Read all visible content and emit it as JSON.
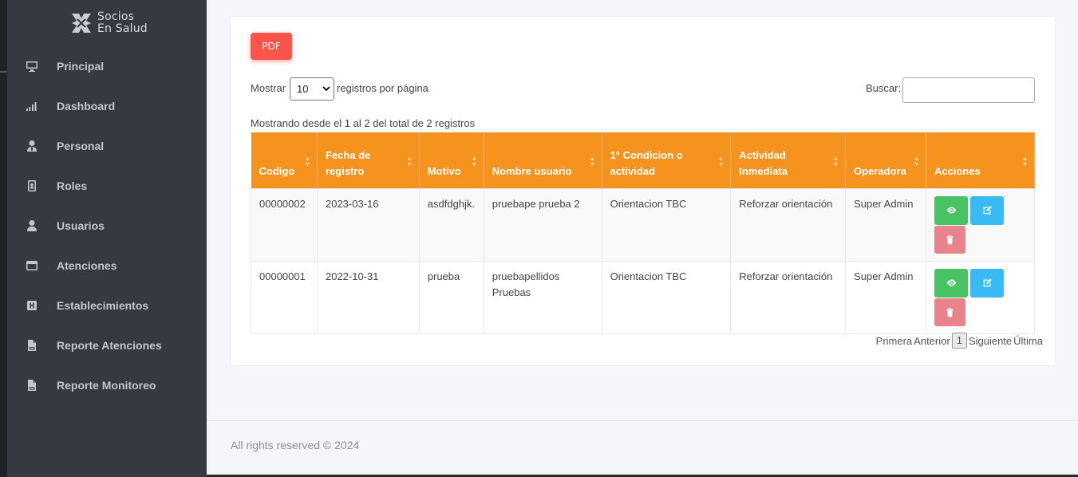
{
  "brand": {
    "line1": "Socios",
    "line2": "En Salud"
  },
  "sidebar": {
    "items": [
      {
        "label": "Principal",
        "icon": "desktop-icon"
      },
      {
        "label": "Dashboard",
        "icon": "signal-icon"
      },
      {
        "label": "Personal",
        "icon": "user-tie-icon"
      },
      {
        "label": "Roles",
        "icon": "id-badge-icon"
      },
      {
        "label": "Usuarios",
        "icon": "user-icon"
      },
      {
        "label": "Atenciones",
        "icon": "window-icon"
      },
      {
        "label": "Establecimientos",
        "icon": "hospital-icon"
      },
      {
        "label": "Reporte Atenciones",
        "icon": "file-pdf-icon"
      },
      {
        "label": "Reporte Monitoreo",
        "icon": "file-pdf-icon"
      }
    ]
  },
  "toolbar": {
    "pdf_label": "PDF"
  },
  "length": {
    "prefix": "Mostrar",
    "value": "10",
    "suffix": "registros por página"
  },
  "search": {
    "label": "Buscar:",
    "value": ""
  },
  "info": "Mostrando desde el 1 al 2 del total de 2 registros",
  "table": {
    "headers": [
      "Codigo",
      "Fecha de registro",
      "Motivo",
      "Nombre usuario",
      "1° Condicion o actividad",
      "Actividad Inmediata",
      "Operadora",
      "Acciones"
    ],
    "rows": [
      [
        "00000002",
        "2023-03-16",
        "asdfdghjk.",
        "pruebape prueba 2",
        "Orientacion TBC",
        "Reforzar orientación",
        "Super Admin"
      ],
      [
        "00000001",
        "2022-10-31",
        "prueba",
        "pruebapellidos Pruebas",
        "Orientacion TBC",
        "Reforzar orientación",
        "Super Admin"
      ]
    ]
  },
  "pager": {
    "first": "Primera",
    "prev": "Anterior",
    "current": "1",
    "next": "Siguiente",
    "last": "Última"
  },
  "footer": "All rights reserved © 2024",
  "colors": {
    "sidebar": "#343a40",
    "header": "#f6921e",
    "pdf": "#fc544b",
    "view": "#47c363",
    "edit": "#3abaf4",
    "delete": "#e9838b"
  }
}
